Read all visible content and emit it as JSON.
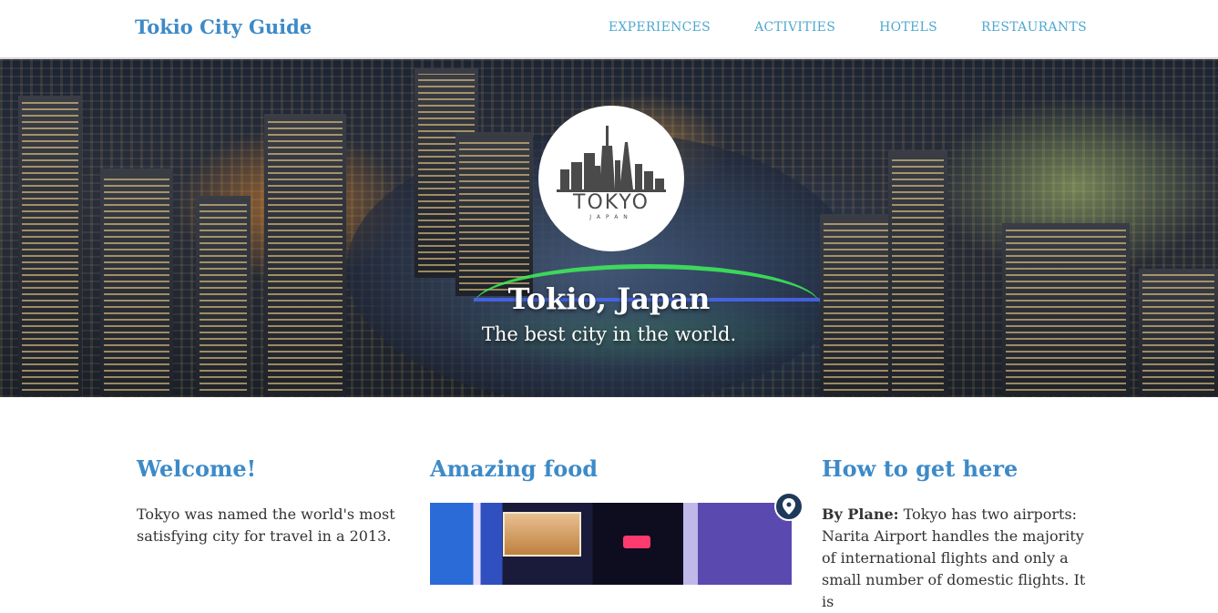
{
  "nav": {
    "brand": "Tokio City Guide",
    "items": [
      {
        "label": "EXPERIENCES"
      },
      {
        "label": "ACTIVITIES"
      },
      {
        "label": "HOTELS"
      },
      {
        "label": "RESTAURANTS"
      }
    ]
  },
  "hero": {
    "logo_text": "TOKYO",
    "logo_subtext": "JAPAN",
    "title": "Tokio, Japan",
    "subtitle": "The best city in the world."
  },
  "sections": {
    "welcome": {
      "heading": "Welcome!",
      "text": "Tokyo was named the world's most satisfying city for travel in a 2013."
    },
    "food": {
      "heading": "Amazing food",
      "icon": "location-pin-icon"
    },
    "getting_here": {
      "heading": "How to get here",
      "label": "By Plane:",
      "text": " Tokyo has two airports: Narita Airport handles the majority of international flights and only a small number of domestic flights. It is"
    }
  },
  "colors": {
    "brand": "#3d8ac8",
    "nav_link": "#4fa8d0",
    "pin": "#1e3a5a"
  }
}
